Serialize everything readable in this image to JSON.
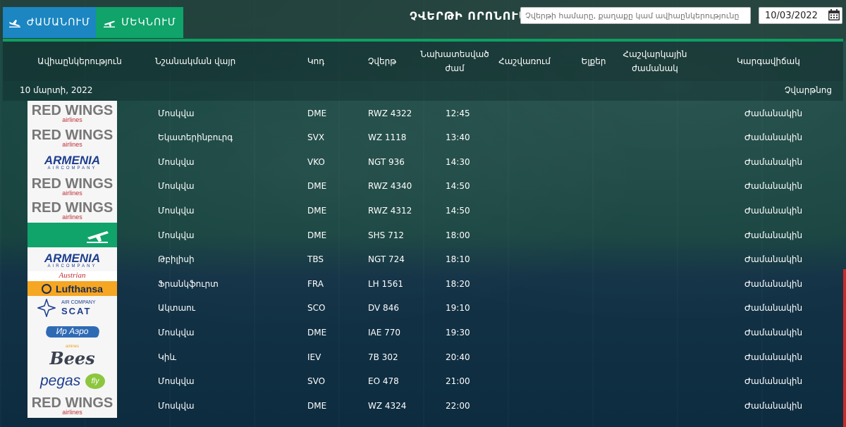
{
  "tabs": {
    "arrivals": "ԺԱՄԱՆՈՒՄ",
    "departures": "ՄԵԿՆՈՒՄ"
  },
  "search": {
    "title": "ՉՎԵՐԹԻ ՈՐՈՆՈՒՄ",
    "placeholder": "Չվերթի համարը, քաղաքը կամ ավիաընկերությունը",
    "date_value": "10/03/2022"
  },
  "columns": [
    "Ավիաընկերություն",
    "Նշանակման վայր",
    "Կոդ",
    "Չվերթ",
    "Նախատեսված ժամ",
    "Հաշվառում",
    "Ելքեր",
    "Հաշվարկային ժամանակ",
    "Կարգավիճակ"
  ],
  "day_label": "10 մարտի, 2022",
  "departed_label": "Չվարթնոց",
  "colors": {
    "tab_arrivals": "#1b86c2",
    "tab_departures": "#10a36a",
    "accent": "#0f9e63"
  },
  "flights": [
    {
      "airline_logo": "RED WINGS",
      "logo_sub": "airlines",
      "logo_style": "redwings",
      "destination": "Մոսկվա",
      "code": "DME",
      "flight": "RWZ 4322",
      "time": "12:45",
      "status": "Ժամանակին"
    },
    {
      "airline_logo": "RED WINGS",
      "logo_sub": "airlines",
      "logo_style": "redwings",
      "destination": "Եկատերինբուրգ",
      "code": "SVX",
      "flight": "WZ 1118",
      "time": "13:40",
      "status": "Ժամանակին"
    },
    {
      "airline_logo": "ARMENIA",
      "logo_sub": "AIRCOMPANY",
      "logo_style": "armenia",
      "destination": "Մոսկվա",
      "code": "VKO",
      "flight": "NGT 936",
      "time": "14:30",
      "status": "Ժամանակին"
    },
    {
      "airline_logo": "RED WINGS",
      "logo_sub": "airlines",
      "logo_style": "redwings",
      "destination": "Մոսկվա",
      "code": "DME",
      "flight": "RWZ 4340",
      "time": "14:50",
      "status": "Ժամանակին"
    },
    {
      "airline_logo": "RED WINGS",
      "logo_sub": "airlines",
      "logo_style": "redwings",
      "destination": "Մոսկվա",
      "code": "DME",
      "flight": "RWZ 4312",
      "time": "14:50",
      "status": "Ժամանակին"
    },
    {
      "airline_logo": "",
      "logo_sub": "",
      "logo_style": "plane",
      "destination": "Մոսկվա",
      "code": "DME",
      "flight": "SHS 712",
      "time": "18:00",
      "status": "Ժամանակին"
    },
    {
      "airline_logo": "ARMENIA",
      "logo_sub": "AIRCOMPANY",
      "logo_style": "armenia",
      "destination": "Թբիլիսի",
      "code": "TBS",
      "flight": "NGT 724",
      "time": "18:10",
      "status": "Ժամանակին"
    },
    {
      "airline_logo": "Lufthansa",
      "logo_sub": "Austrian",
      "logo_style": "lufthansa",
      "destination": "Ֆրանկֆուրտ",
      "code": "FRA",
      "flight": "LH 1561",
      "time": "18:20",
      "status": "Ժամանակին"
    },
    {
      "airline_logo": "SCAT",
      "logo_sub": "AIR COMPANY",
      "logo_style": "scat",
      "destination": "Ակտաու",
      "code": "SCO",
      "flight": "DV 846",
      "time": "19:10",
      "status": "Ժամանակին"
    },
    {
      "airline_logo": "Ир Аэро",
      "logo_sub": "",
      "logo_style": "iraero",
      "destination": "Մոսկվա",
      "code": "DME",
      "flight": "IAE 770",
      "time": "19:30",
      "status": "Ժամանակին"
    },
    {
      "airline_logo": "Bees",
      "logo_sub": "airlines",
      "logo_style": "bees",
      "destination": "Կիև",
      "code": "IEV",
      "flight": "7B 302",
      "time": "20:40",
      "status": "Ժամանակին"
    },
    {
      "airline_logo": "pegas",
      "logo_sub": "fly",
      "logo_style": "pegas",
      "destination": "Մոսկվա",
      "code": "SVO",
      "flight": "EO 478",
      "time": "21:00",
      "status": "Ժամանակին"
    },
    {
      "airline_logo": "RED WINGS",
      "logo_sub": "airlines",
      "logo_style": "redwings",
      "destination": "Մոսկվա",
      "code": "DME",
      "flight": "WZ 4324",
      "time": "22:00",
      "status": "Ժամանակին"
    }
  ]
}
